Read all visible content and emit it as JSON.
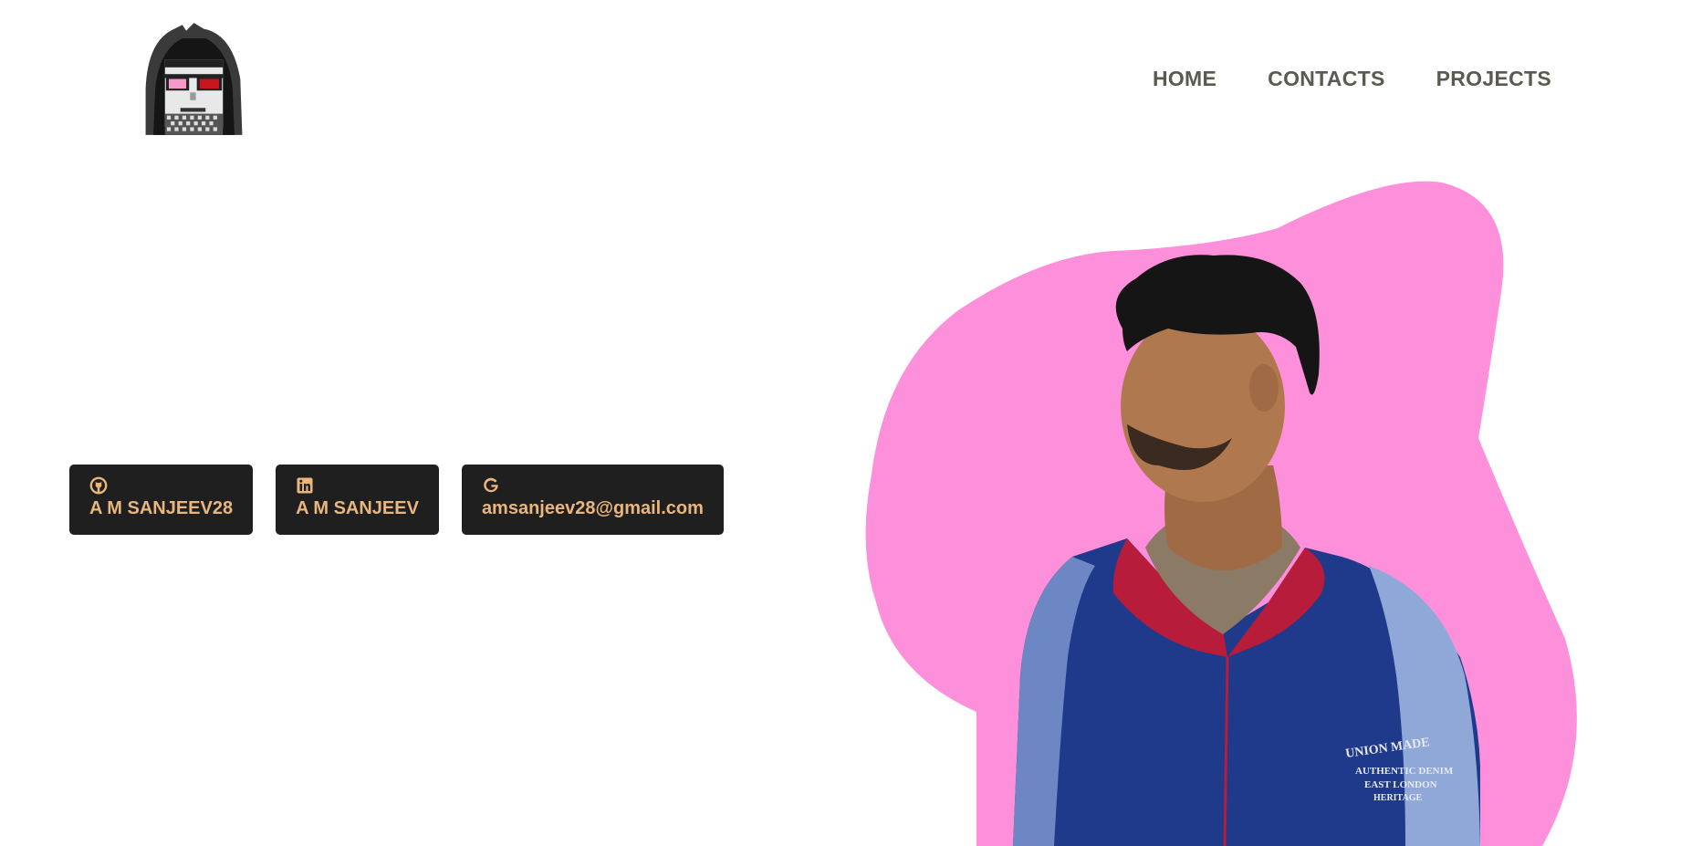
{
  "nav": {
    "items": [
      {
        "label": "HOME"
      },
      {
        "label": "CONTACTS"
      },
      {
        "label": "PROJECTS"
      }
    ]
  },
  "contacts": [
    {
      "icon": "github-icon",
      "label": "A M SANJEEV28"
    },
    {
      "icon": "linkedin-icon",
      "label": "A M SANJEEV"
    },
    {
      "icon": "google-icon",
      "label": "amsanjeev28@gmail.com"
    }
  ],
  "colors": {
    "button_bg": "#1f1f1f",
    "button_text": "#e9b67e",
    "nav_text": "#5a5a4e",
    "blob": "#fd8fdb",
    "jacket": "#1f3a8a"
  }
}
